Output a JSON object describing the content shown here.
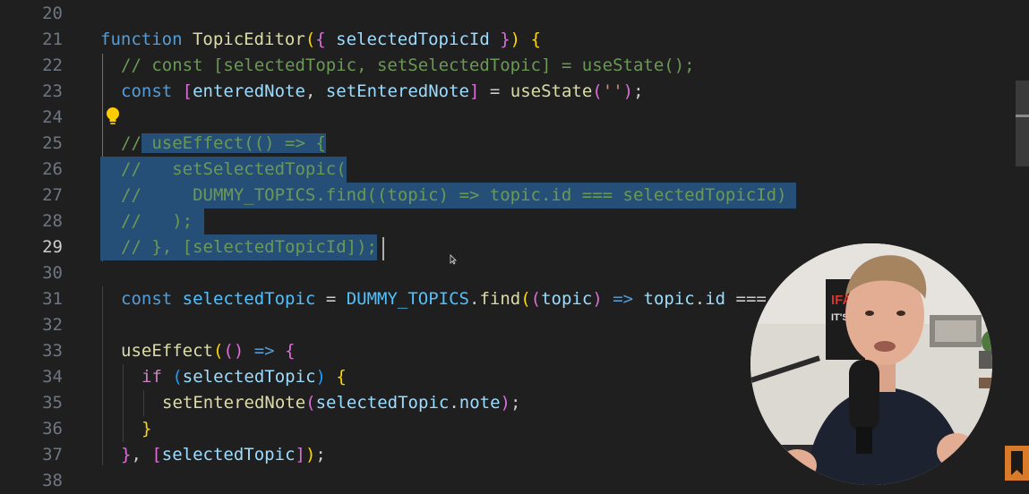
{
  "editor": {
    "line_numbers": [
      "20",
      "21",
      "22",
      "23",
      "24",
      "25",
      "26",
      "27",
      "28",
      "29",
      "30",
      "31",
      "32",
      "33",
      "34",
      "35",
      "36",
      "37",
      "38"
    ],
    "active_line": "29"
  },
  "code": {
    "l21": [
      "function",
      "TopicEditor",
      "(",
      "{",
      "selectedTopicId",
      "}",
      ")",
      "{"
    ],
    "l22": "// const [selectedTopic, setSelectedTopic] = useState();",
    "l23": [
      "const",
      "[",
      "enteredNote",
      ", ",
      "setEnteredNote",
      "]",
      " = ",
      "useState",
      "(",
      "''",
      ")",
      ";"
    ],
    "l25": [
      "//",
      " useEffect(() => {"
    ],
    "l26": "//   setSelectedTopic(",
    "l27": "//     DUMMY_TOPICS.find((topic) => topic.id === selectedTopicId)",
    "l28": "//   );",
    "l29": "// }, [selectedTopicId]);",
    "l31": [
      "const",
      "selectedTopic",
      " = ",
      "DUMMY_TOPICS",
      ".",
      "find",
      "(",
      "(",
      "topic",
      ")",
      " => ",
      "topic",
      ".",
      "id",
      " ==="
    ],
    "l33": [
      "useEffect",
      "(",
      "()",
      " => ",
      "{"
    ],
    "l34": [
      "if",
      "(",
      "selectedTopic",
      ")",
      "{"
    ],
    "l35": [
      "setEnteredNote",
      "(",
      "selectedTopic",
      ".",
      "note",
      ")",
      ";"
    ],
    "l36": "}",
    "l37": [
      "}",
      ", ",
      "[",
      "selectedTopic",
      "]",
      ")",
      ";"
    ]
  },
  "webcam": {
    "poster_line1": "IFALSE",
    "poster_line2": "IT'S TRUE"
  },
  "icons": [
    "lightbulb-icon",
    "mouse-pointer-icon",
    "bookmark-icon"
  ]
}
